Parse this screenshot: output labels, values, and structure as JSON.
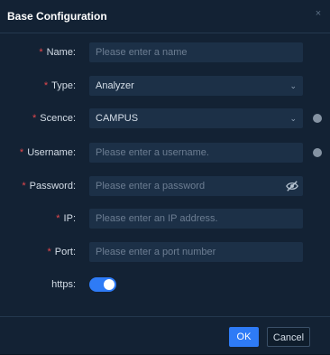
{
  "dialog": {
    "title": "Base Configuration",
    "close_glyph": "×"
  },
  "form": {
    "required_mark": "*",
    "name": {
      "label": "Name:",
      "placeholder": "Please enter a name"
    },
    "type": {
      "label": "Type:",
      "value": "Analyzer"
    },
    "scence": {
      "label": "Scence:",
      "value": "CAMPUS"
    },
    "username": {
      "label": "Username:",
      "placeholder": "Please enter a username."
    },
    "password": {
      "label": "Password:",
      "placeholder": "Please enter a password"
    },
    "ip": {
      "label": "IP:",
      "placeholder": "Please enter an IP address."
    },
    "port": {
      "label": "Port:",
      "placeholder": "Please enter a port number"
    },
    "https": {
      "label": "https:",
      "enabled": true
    }
  },
  "footer": {
    "ok_label": "OK",
    "cancel_label": "Cancel"
  },
  "colors": {
    "accent": "#2e7bf6",
    "required": "#e5484d",
    "dialog_bg": "#132234",
    "input_bg": "#1c3047"
  },
  "icons": {
    "close": "close-icon",
    "dropdown": "chevron-down-icon",
    "password_visibility": "eye-off-icon",
    "help": "help-dot-icon"
  }
}
